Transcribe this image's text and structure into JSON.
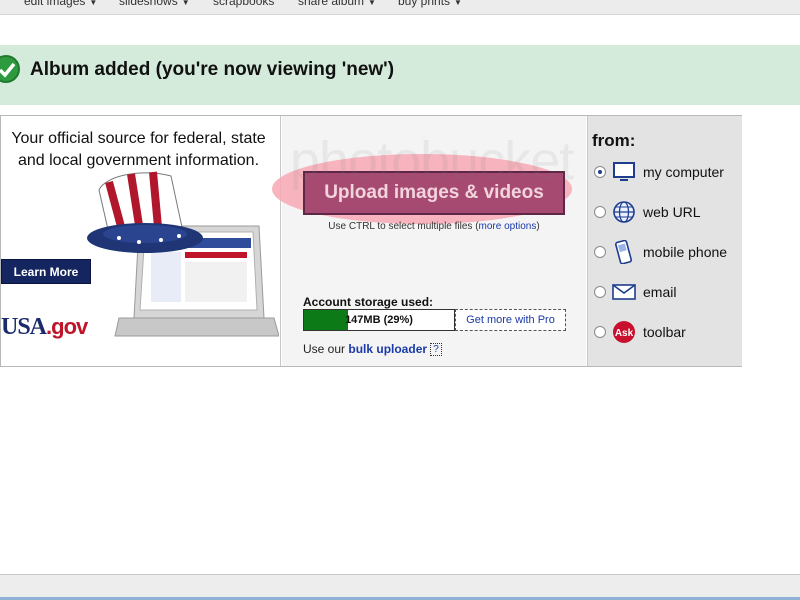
{
  "nav": {
    "items": [
      {
        "label": "edit images",
        "caret": "▼"
      },
      {
        "label": "slideshows",
        "caret": "▼"
      },
      {
        "label": "scrapbooks",
        "caret": ""
      },
      {
        "label": "share album",
        "caret": "▼"
      },
      {
        "label": "buy prints",
        "caret": "▼"
      }
    ]
  },
  "banner": {
    "message": "Album added (you're now viewing 'new')",
    "icon": "check-icon",
    "color": "#d4ebdc"
  },
  "ad": {
    "headline": "Your official source for federal, state and local government information.",
    "button": "Learn More",
    "logo_main": "USA",
    "logo_suffix": ".gov"
  },
  "upload": {
    "button": "Upload images & videos",
    "hint_prefix": "Use CTRL to select multiple files (",
    "hint_link": "more options",
    "hint_suffix": ")",
    "storage_label": "Account storage used:",
    "storage_text": "147MB (29%)",
    "storage_fraction": 0.29,
    "pro_link": "Get more with Pro",
    "bulk_prefix": "Use our ",
    "bulk_link": "bulk uploader",
    "help": "?"
  },
  "watermark": "photobucket",
  "sources": {
    "title": "from:",
    "items": [
      {
        "label": "my computer",
        "icon": "monitor-icon",
        "selected": true
      },
      {
        "label": "web URL",
        "icon": "globe-icon",
        "selected": false
      },
      {
        "label": "mobile phone",
        "icon": "phone-icon",
        "selected": false
      },
      {
        "label": "email",
        "icon": "envelope-icon",
        "selected": false
      },
      {
        "label": "toolbar",
        "icon": "ask-icon",
        "selected": false
      }
    ]
  },
  "colors": {
    "upload_button": "#a74a71",
    "storage_fill": "#0d7a18",
    "link": "#1a3aa8"
  }
}
